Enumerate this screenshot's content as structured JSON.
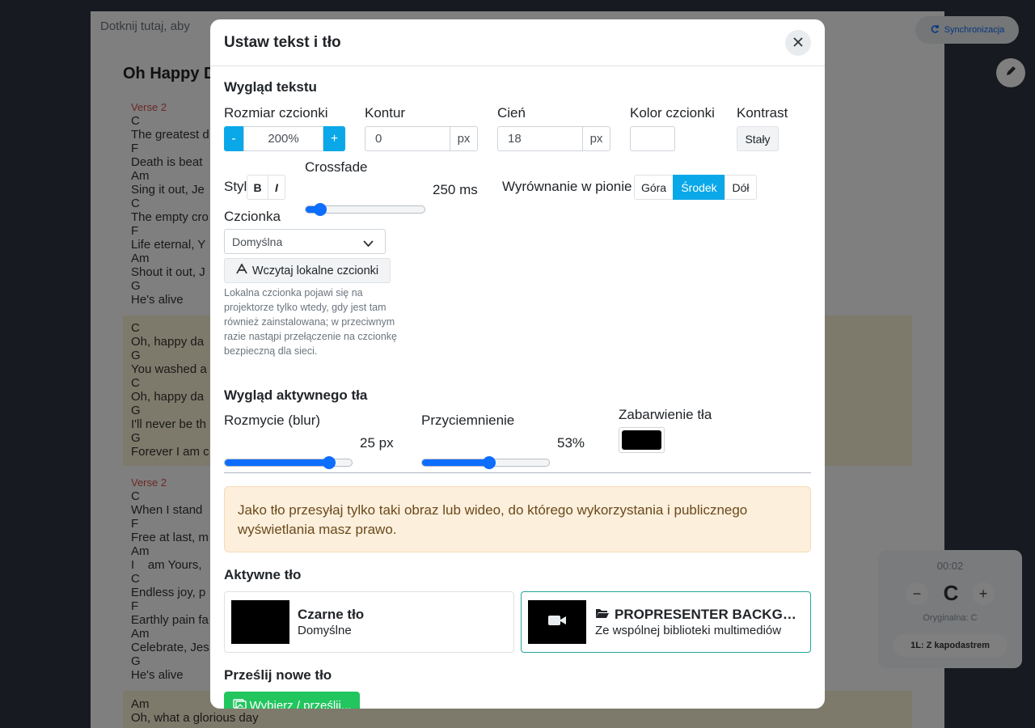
{
  "background": {
    "hint": "Dotknij tutaj, aby",
    "song_title": "Oh Happy D",
    "sync_label": "Synchronizacja",
    "verse1_label": "Verse 2",
    "verse1_text": "C\nThe greatest d\nF\nDeath is beat\nAm\nSing it out, Je\nC\nThe empty cro\nF\nLife eternal, Y\nAm\nShout it out, J\nG\nHe's alive",
    "chorus1_text": "C\nOh, happy da\nG\nYou washed a\nC\nOh, happy da\nG\nI'll never be th\nG\nForever I am c",
    "verse2_label": "Verse 2",
    "verse2_text": "C\nWhen I stand\nF\nFree at last, m\nAm\nI    am Yours,\nC\nEndless joy, p\nF\nEarthly pain fa\nAm\nCelebrate, Jes\nG\nHe's alive",
    "chorus2_text": "Am\nOh, what a glorious day",
    "key_panel": {
      "time": "00:02",
      "key": "C",
      "minus": "−",
      "plus": "+",
      "original": "Oryginalna: C",
      "capo": "1L: Z kapodastrem"
    }
  },
  "modal": {
    "title": "Ustaw tekst i tło",
    "text_section": {
      "heading": "Wygląd tekstu",
      "font_size": {
        "label": "Rozmiar czcionki",
        "minus": "-",
        "value": "200%",
        "plus": "+"
      },
      "outline": {
        "label": "Kontur",
        "value": "0",
        "unit": "px"
      },
      "shadow": {
        "label": "Cień",
        "value": "18",
        "unit": "px"
      },
      "font_color": {
        "label": "Kolor czcionki",
        "color": "#ffffff"
      },
      "contrast": {
        "label": "Kontrast",
        "button": "Stały"
      },
      "style": {
        "label": "Styl",
        "bold": "B",
        "italic": "I"
      },
      "crossfade": {
        "label": "Crossfade",
        "value": "250 ms",
        "fraction": 0.12
      },
      "vertical_align": {
        "label": "Wyrównanie w pionie",
        "options": [
          "Góra",
          "Środek",
          "Dół"
        ],
        "selected": "Środek"
      },
      "font": {
        "label": "Czcionka",
        "selected": "Domyślna",
        "load_button": "Wczytaj lokalne czcionki",
        "help": "Lokalna czcionka pojawi się na projektorze tylko wtedy, gdy jest tam również zainstalowana; w przeciwnym razie nastąpi przełączenie na czcionkę bezpieczną dla sieci."
      }
    },
    "background_section": {
      "heading": "Wygląd aktywnego tła",
      "blur": {
        "label": "Rozmycie (blur)",
        "value": "25 px",
        "fraction": 0.82
      },
      "dim": {
        "label": "Przyciemnienie",
        "value": "53%",
        "fraction": 0.53
      },
      "tint": {
        "label": "Zabarwienie tła",
        "color": "#000000"
      }
    },
    "warning": "Jako tło przesyłaj tylko taki obraz lub wideo, do którego wykorzystania i publicznego wyświetlania masz prawo.",
    "active_bg": {
      "heading": "Aktywne tło",
      "cards": [
        {
          "title": "Czarne tło",
          "subtitle": "Domyślne"
        },
        {
          "title": "PROPRESENTER BACKGROUNDS",
          "subtitle": "Ze wspólnej biblioteki multimediów"
        }
      ]
    },
    "upload": {
      "heading": "Prześlij nowe tło",
      "button": "Wybierz / prześlij..."
    }
  }
}
